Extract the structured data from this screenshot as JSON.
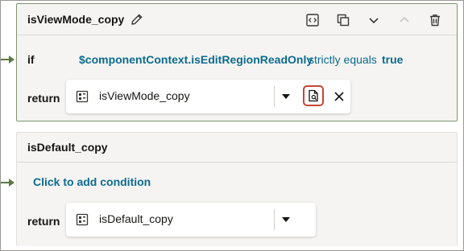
{
  "rule1": {
    "title": "isViewMode_copy",
    "if_label": "if",
    "condition": {
      "left": "$componentContext.isEditRegionReadOnly",
      "operator": "strictly equals",
      "right": "true"
    },
    "return_label": "return",
    "return_value": "isViewMode_copy",
    "actions": [
      "code-icon",
      "duplicate-icon",
      "chevron-down-icon",
      "chevron-up-icon",
      "trash-icon"
    ]
  },
  "rule2": {
    "title": "isDefault_copy",
    "add_condition": "Click to add condition",
    "return_label": "return",
    "return_value": "isDefault_copy"
  },
  "colors": {
    "accent_link": "#0c6b8f",
    "connector": "#5b7a45",
    "highlight": "#c74634"
  }
}
